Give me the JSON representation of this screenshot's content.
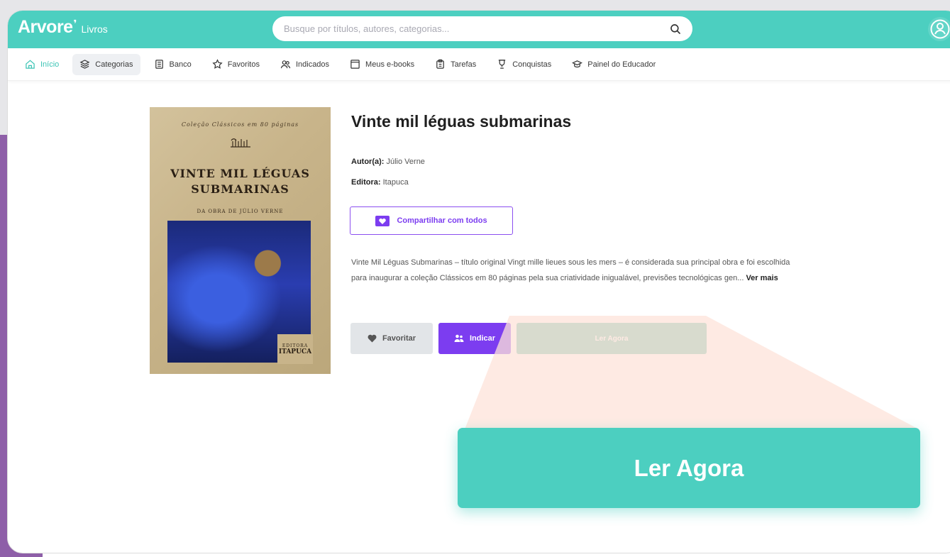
{
  "app": {
    "logo_main": "Arvore",
    "logo_sub": "Livros"
  },
  "search": {
    "placeholder": "Busque por títulos, autores, categorias..."
  },
  "nav": {
    "items": [
      {
        "label": "Início",
        "icon": "home-icon"
      },
      {
        "label": "Categorias",
        "icon": "layers-icon"
      },
      {
        "label": "Banco",
        "icon": "bank-icon"
      },
      {
        "label": "Favoritos",
        "icon": "star-icon"
      },
      {
        "label": "Indicados",
        "icon": "users-icon"
      },
      {
        "label": "Meus e-books",
        "icon": "book-icon"
      },
      {
        "label": "Tarefas",
        "icon": "clipboard-icon"
      },
      {
        "label": "Conquistas",
        "icon": "trophy-icon"
      },
      {
        "label": "Painel do Educador",
        "icon": "graduation-cap-icon"
      }
    ]
  },
  "book": {
    "cover": {
      "series": "Coleção Clássicos em 80 páginas",
      "title_line1": "VINTE MIL LÉGUAS",
      "title_line2": "SUBMARINAS",
      "author_line": "DA OBRA DE JÚLIO VERNE",
      "publisher_line1": "EDITORA",
      "publisher_line2": "ITAPUCA"
    },
    "title": "Vinte mil léguas submarinas",
    "author_label": "Autor(a):",
    "author": "Júlio Verne",
    "publisher_label": "Editora:",
    "publisher": "Itapuca",
    "share_label": "Compartilhar com todos",
    "description": "Vinte Mil Léguas Submarinas – título original Vingt mille lieues sous les mers – é considerada sua principal obra e foi escolhida para inaugurar a coleção Clássicos em 80 páginas pela sua criatividade inigualável, previsões tecnológicas gen...",
    "see_more": "Ver mais"
  },
  "actions": {
    "favorite": "Favoritar",
    "recommend": "Indicar",
    "read_now": "Ler Agora"
  },
  "callout": {
    "label": "Ler Agora"
  },
  "colors": {
    "teal": "#4ccfc0",
    "purple": "#7c3df0",
    "read_button": "#6ac2ac"
  }
}
